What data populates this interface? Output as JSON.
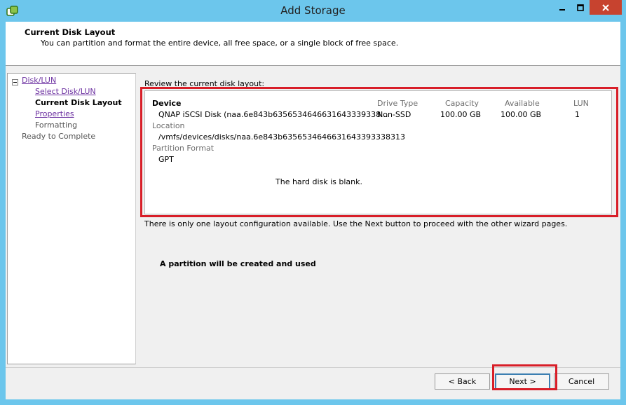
{
  "window": {
    "title": "Add Storage",
    "colors": {
      "frame": "#6cc6ec",
      "close": "#c7432f",
      "highlight": "#d81e28"
    }
  },
  "header": {
    "title": "Current Disk Layout",
    "subtitle": "You can partition and format the entire device, all free space, or a single block of free space."
  },
  "nav": {
    "root": "Disk/LUN",
    "items": [
      {
        "label": "Select Disk/LUN",
        "state": "link"
      },
      {
        "label": "Current Disk Layout",
        "state": "current"
      },
      {
        "label": "Properties",
        "state": "link"
      },
      {
        "label": "Formatting",
        "state": "pending"
      }
    ],
    "final": "Ready to Complete"
  },
  "main": {
    "review_label": "Review the current disk layout:",
    "columns": {
      "device": "Device",
      "drive_type": "Drive Type",
      "capacity": "Capacity",
      "available": "Available",
      "lun": "LUN"
    },
    "device_row": {
      "name": "QNAP iSCSI Disk (naa.6e843b6356534646631643339338...",
      "drive_type": "Non-SSD",
      "capacity": "100.00 GB",
      "available": "100.00 GB",
      "lun": "1"
    },
    "location_label": "Location",
    "location_value": "/vmfs/devices/disks/naa.6e843b6356534646631643393338313",
    "partition_format_label": "Partition Format",
    "partition_format_value": "GPT",
    "blank_message": "The hard disk is blank.",
    "info": "There is only one layout configuration available. Use the Next button to proceed with the other wizard pages.",
    "partition_message": "A partition will be created and used"
  },
  "footer": {
    "back": "< Back",
    "next": "Next >",
    "cancel": "Cancel"
  }
}
